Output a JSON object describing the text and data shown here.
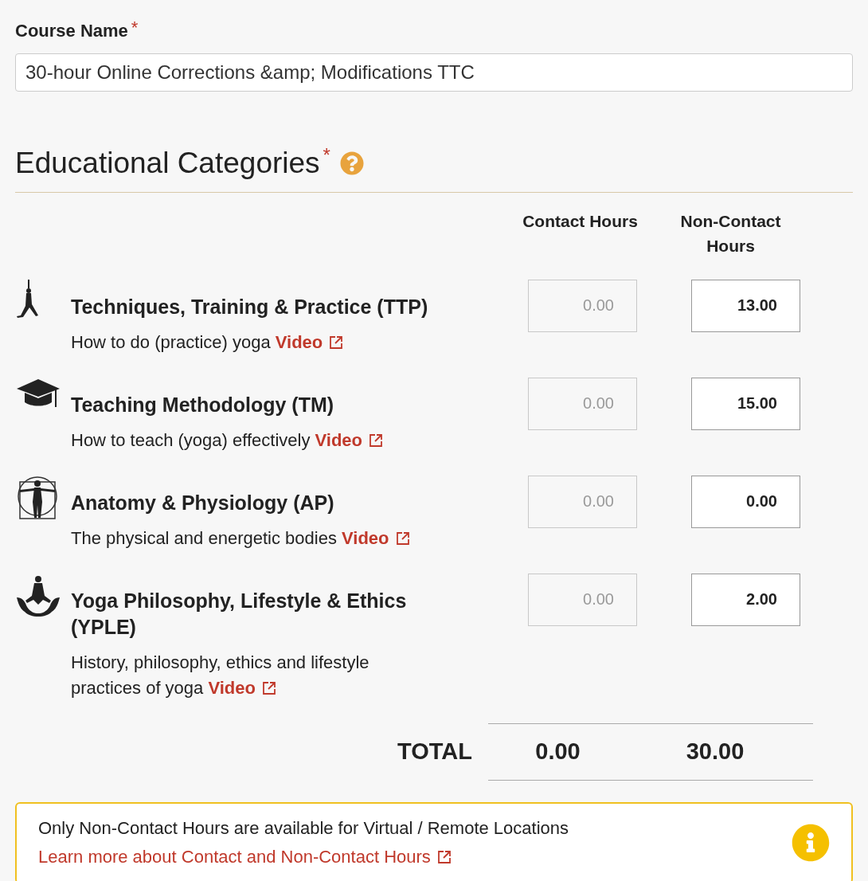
{
  "course_name": {
    "label": "Course Name",
    "required_mark": "*",
    "value": "30-hour Online Corrections &amp; Modifications TTC"
  },
  "section": {
    "title": "Educational Categories",
    "required_mark": "*"
  },
  "columns": [
    "Contact Hours",
    "Non-Contact Hours"
  ],
  "categories": [
    {
      "title": "Techniques, Training & Practice (TTP)",
      "description": "How to do (practice) yoga",
      "link": "Video",
      "contact": {
        "value": "0.00",
        "disabled": true
      },
      "non_contact": {
        "value": "13.00",
        "disabled": false
      }
    },
    {
      "title": "Teaching Methodology (TM)",
      "description": "How to teach (yoga) effectively",
      "link": "Video",
      "contact": {
        "value": "0.00",
        "disabled": true
      },
      "non_contact": {
        "value": "15.00",
        "disabled": false
      }
    },
    {
      "title": "Anatomy & Physiology (AP)",
      "description": "The physical and energetic bodies",
      "link": "Video",
      "contact": {
        "value": "0.00",
        "disabled": true
      },
      "non_contact": {
        "value": "0.00",
        "disabled": false
      }
    },
    {
      "title": "Yoga Philosophy, Lifestyle & Ethics (YPLE)",
      "description": "History, philosophy, ethics and lifestyle practices of yoga",
      "link": "Video",
      "contact": {
        "value": "0.00",
        "disabled": true
      },
      "non_contact": {
        "value": "2.00",
        "disabled": false
      }
    }
  ],
  "total": {
    "label": "TOTAL",
    "contact": "0.00",
    "non_contact": "30.00"
  },
  "notice": {
    "text": "Only Non-Contact Hours are available for Virtual / Remote Locations",
    "link": "Learn more about Contact and Non-Contact Hours"
  }
}
